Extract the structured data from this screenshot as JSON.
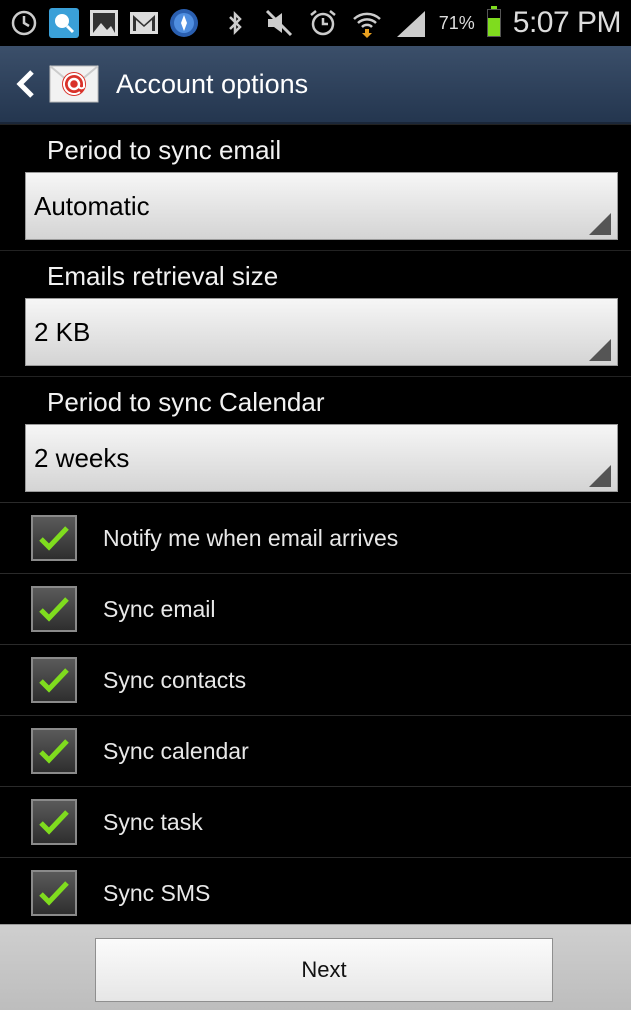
{
  "status_bar": {
    "battery_percent": "71%",
    "battery_level": 0.71,
    "time": "5:07 PM",
    "left_icons": [
      "clock-icon",
      "chat-icon",
      "image-icon",
      "gmail-icon",
      "compass-icon"
    ],
    "right_icons": [
      "bluetooth-icon",
      "mute-icon",
      "alarm-icon",
      "wifi-icon",
      "signal-icon"
    ]
  },
  "action_bar": {
    "title": "Account options",
    "back_icon": "chevron-left-icon",
    "app_icon": "email-icon"
  },
  "settings": {
    "sync_email": {
      "label": "Period to sync email",
      "value": "Automatic"
    },
    "retrieval_size": {
      "label": "Emails retrieval size",
      "value": "2 KB"
    },
    "sync_calendar": {
      "label": "Period to sync Calendar",
      "value": "2 weeks"
    }
  },
  "checkboxes": [
    {
      "label": "Notify me when email arrives",
      "checked": true
    },
    {
      "label": "Sync email",
      "checked": true
    },
    {
      "label": "Sync contacts",
      "checked": true
    },
    {
      "label": "Sync calendar",
      "checked": true
    },
    {
      "label": "Sync task",
      "checked": true
    },
    {
      "label": "Sync SMS",
      "checked": true
    }
  ],
  "colors": {
    "action_bar": "#2f435e",
    "check_mark": "#7fdc1e",
    "background": "#000000"
  },
  "bottom_bar": {
    "next_label": "Next"
  }
}
